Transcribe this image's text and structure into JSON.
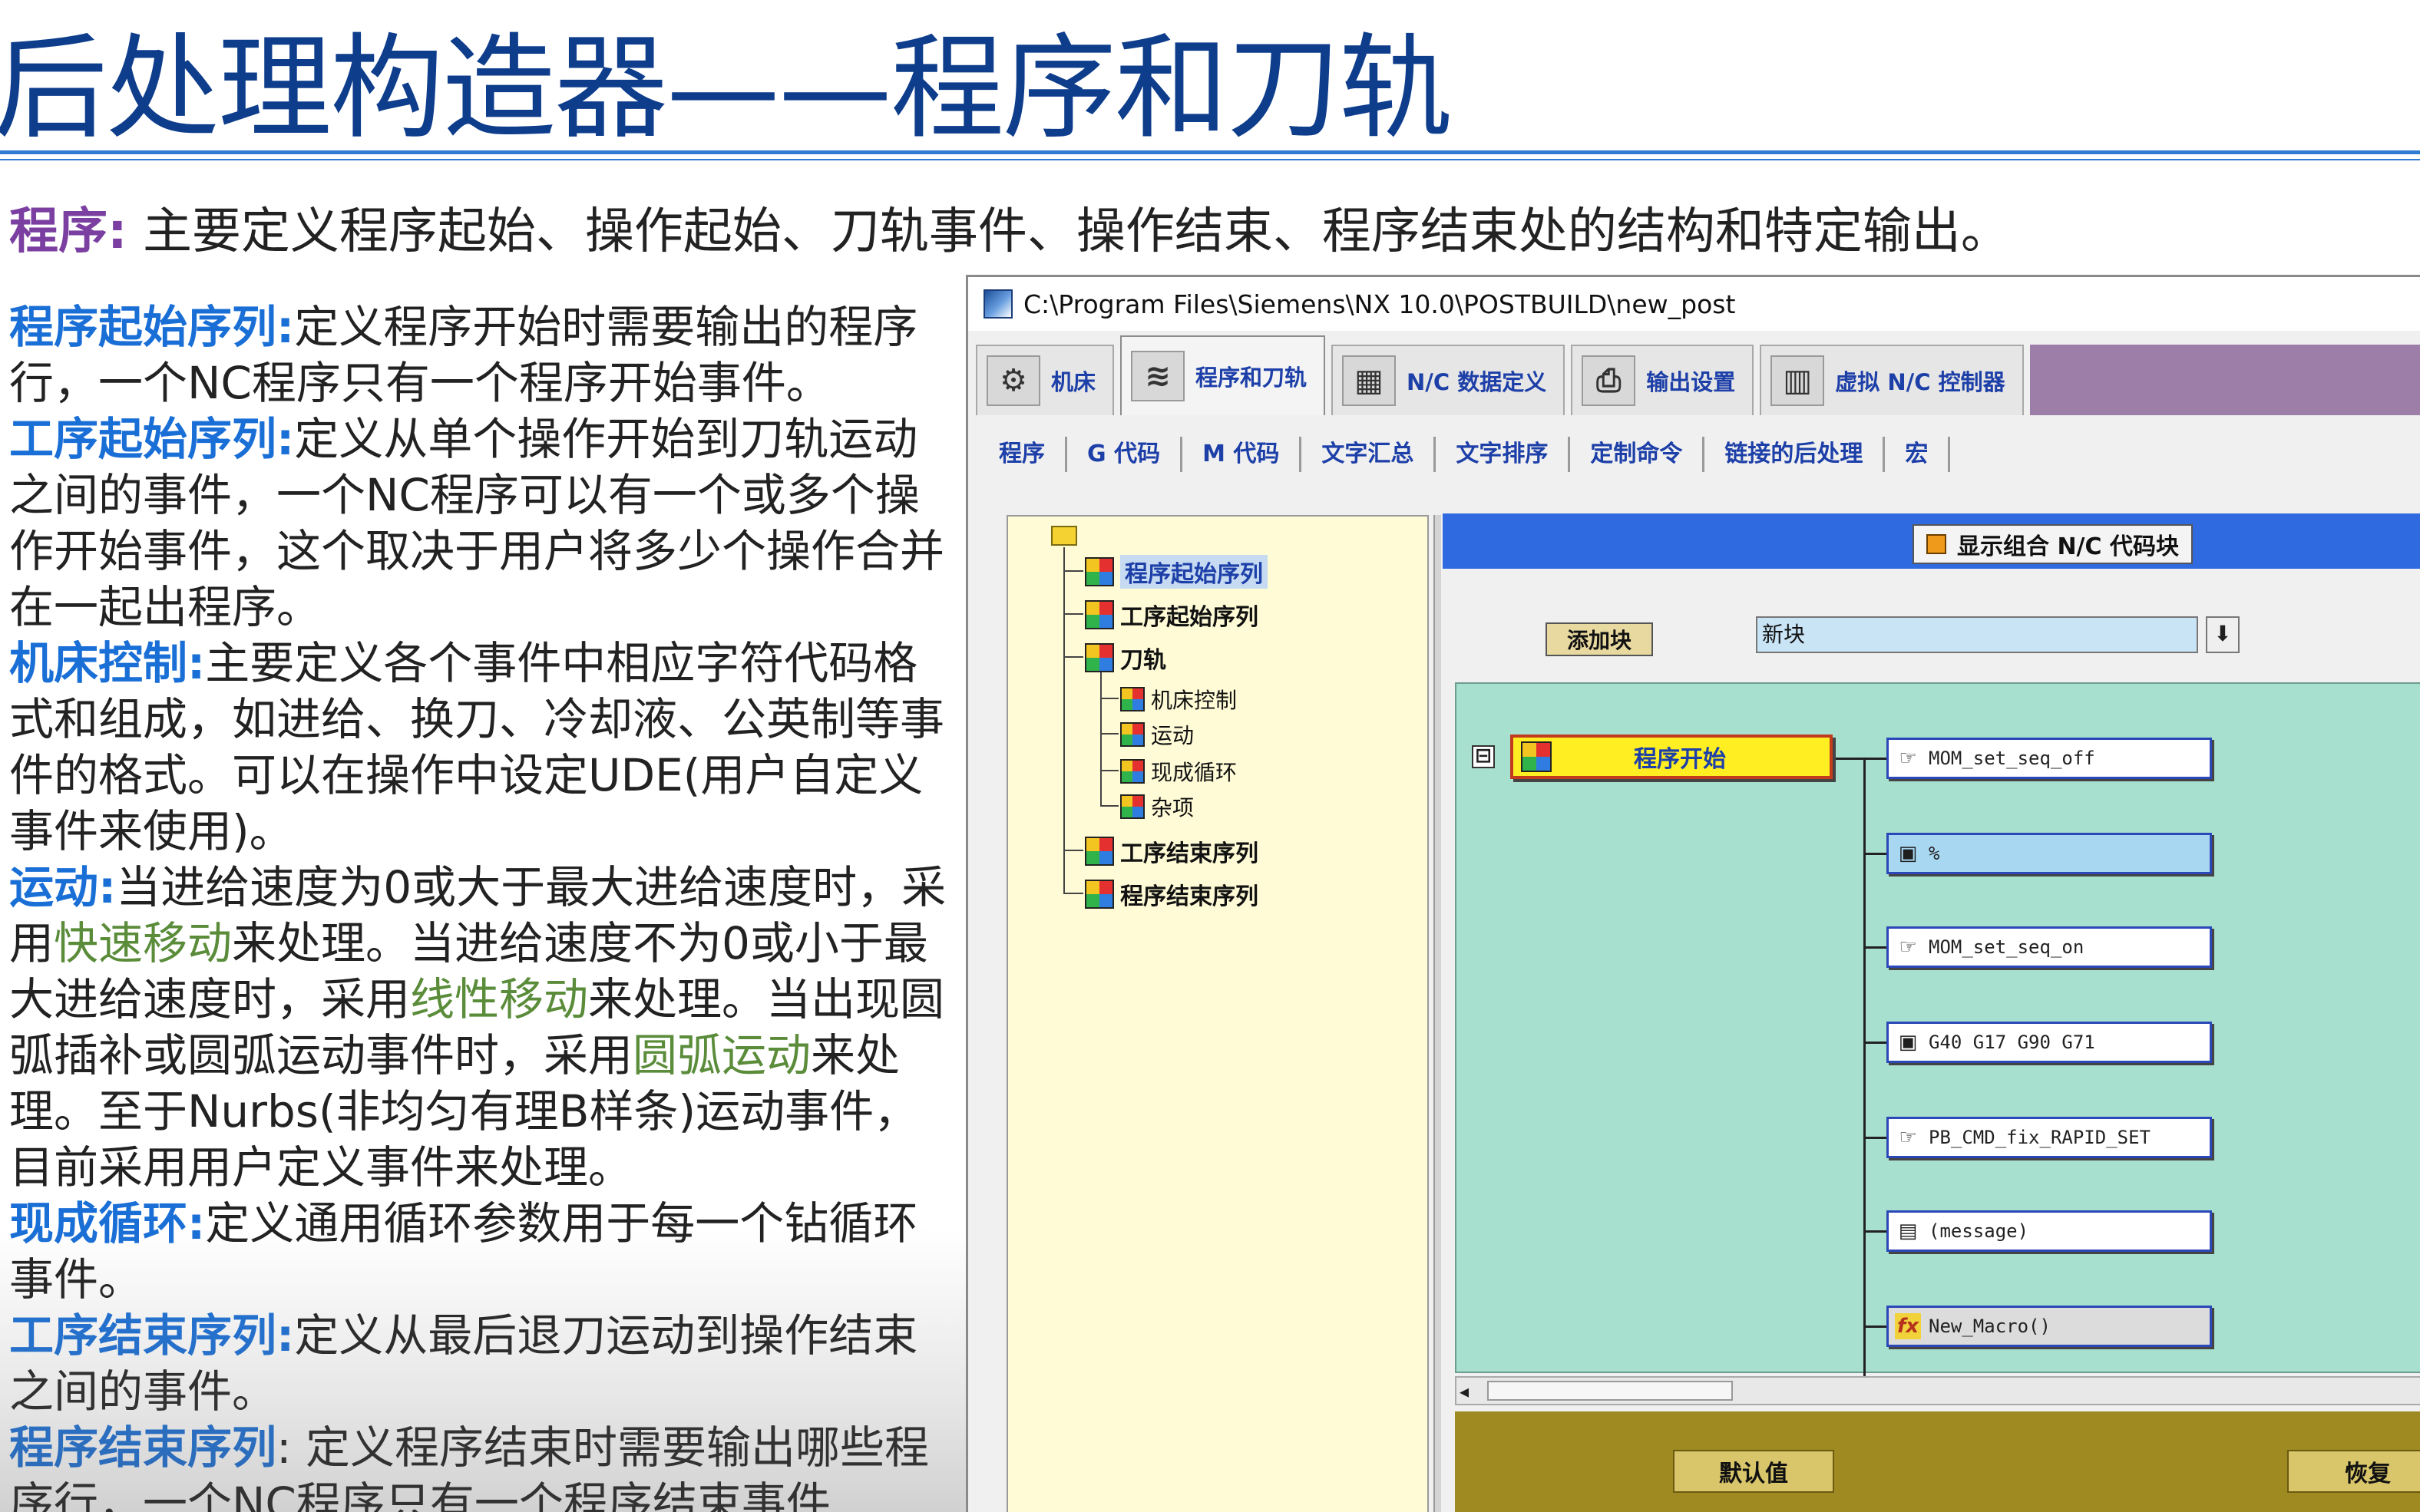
{
  "slide": {
    "title": "后处理构造器——程序和刀轨",
    "intro_keyword": "程序:",
    "intro_text": "主要定义程序起始、操作起始、刀轨事件、操作结束、程序结束处的结构和特定输出。"
  },
  "left_text": {
    "p1_kw": "程序起始序列:",
    "p1_text": "定义程序开始时需要输出的程序行，一个NC程序只有一个程序开始事件。",
    "p2_kw": "工序起始序列:",
    "p2_text": "定义从单个操作开始到刀轨运动之间的事件，一个NC程序可以有一个或多个操作开始事件，这个取决于用户将多少个操作合并在一起出程序。",
    "p3_kw": "机床控制:",
    "p3_text": "主要定义各个事件中相应字符代码格式和组成，如进给、换刀、冷却液、公英制等事件的格式。可以在操作中设定UDE(用户自定义事件来使用)。",
    "p4_kw": "运动:",
    "p4_t1": "当进给速度为0或大于最大进给速度时，采用",
    "p4_h1": "快速移动",
    "p4_t2": "来处理。当进给速度不为0或小于最大进给速度时，采用",
    "p4_h2": "线性移动",
    "p4_t3": "来处理。当出现圆弧插补或圆弧运动事件时，采用",
    "p4_h3": "圆弧运动",
    "p4_t4": "来处理。至于Nurbs(非均匀有理B样条)运动事件，目前采用用户定义事件来处理。",
    "p5_kw": "现成循环:",
    "p5_text": "定义通用循环参数用于每一个钻循环事件。",
    "p6_kw": "工序结束序列:",
    "p6_text": "定义从最后退刀运动到操作结束之间的事件。",
    "p7_kw": "程序结束序列",
    "p7_text": ": 定义程序结束时需要输出哪些程序行，一个NC程序只有一个程序结束事件"
  },
  "window": {
    "title": "C:\\Program Files\\Siemens\\NX 10.0\\POSTBUILD\\new_post",
    "main_tabs": [
      {
        "label": "机床",
        "icon": "machine-tool-icon"
      },
      {
        "label": "程序和刀轨",
        "icon": "program-path-icon"
      },
      {
        "label": "N/C 数据定义",
        "icon": "nc-data-icon"
      },
      {
        "label": "输出设置",
        "icon": "printer-icon"
      },
      {
        "label": "虚拟 N/C 控制器",
        "icon": "controller-icon"
      }
    ],
    "sub_tabs": [
      "程序",
      "G 代码",
      "M 代码",
      "文字汇总",
      "文字排序",
      "定制命令",
      "链接的后处理",
      "宏"
    ],
    "tree": {
      "n1": "程序起始序列",
      "n2": "工序起始序列",
      "n3": "刀轨",
      "n3a": "机床控制",
      "n3b": "运动",
      "n3c": "现成循环",
      "n3d": "杂项",
      "n4": "工序结束序列",
      "n5": "程序结束序列"
    },
    "editor": {
      "combine_label": "显示组合 N/C 代码块",
      "add_block": "添加块",
      "new_block_value": "新块",
      "dropdown_glyph": "⬇",
      "collapse_glyph": "⊟",
      "event_label": "程序开始",
      "blocks": [
        {
          "text": "MOM_set_seq_off",
          "icon": "hand-pointer-icon",
          "glyph": "☞"
        },
        {
          "text": "%",
          "icon": "nc-block-cube-icon",
          "glyph": "▣"
        },
        {
          "text": "MOM_set_seq_on",
          "icon": "hand-pointer-icon",
          "glyph": "☞"
        },
        {
          "text": "G40 G17 G90 G71",
          "icon": "nc-block-cube-icon",
          "glyph": "▣"
        },
        {
          "text": "PB_CMD_fix_RAPID_SET",
          "icon": "hand-pointer-icon",
          "glyph": "☞"
        },
        {
          "text": "(message)",
          "icon": "note-icon",
          "glyph": "▤"
        },
        {
          "text": "New_Macro()",
          "icon": "function-icon",
          "glyph": "fx"
        }
      ],
      "scroll_left": "◂",
      "footer_left": "默认值",
      "footer_right": "恢复"
    }
  },
  "colors": {
    "title": "#0e3d8c",
    "keyword_blue": "#1a6fd6",
    "highlight_green": "#5a8c3a",
    "canvas": "#a8e0d0",
    "event_block": "#ffee22",
    "header_bar": "#2f6ae0"
  }
}
